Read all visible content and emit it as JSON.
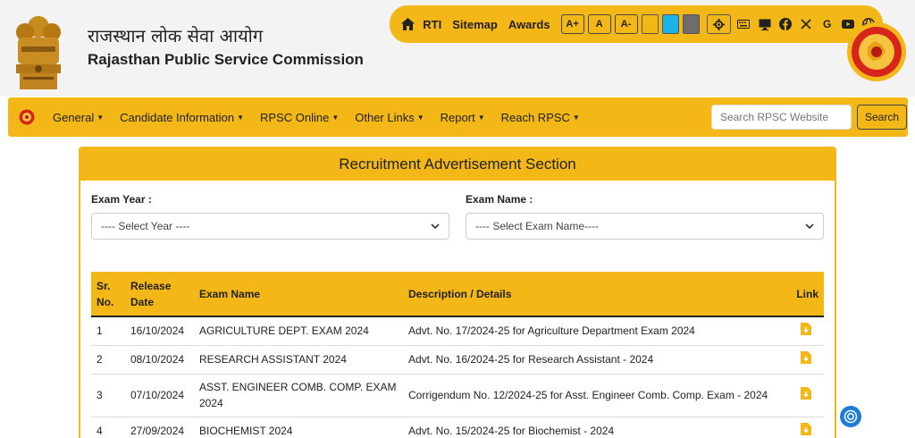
{
  "header": {
    "title_hindi": "राजस्थान लोक सेवा आयोग",
    "title_english": "Rajasthan Public Service Commission"
  },
  "toolbar": {
    "links": [
      "RTI",
      "Sitemap",
      "Awards"
    ],
    "font_buttons": [
      "A+",
      "A",
      "A-"
    ],
    "swatches": [
      "#f3b717",
      "#1ab4e8",
      "#6d6d6d"
    ],
    "icons": [
      "home-icon",
      "gear-icon",
      "keyboard-icon",
      "monitor-icon",
      "facebook-icon",
      "x-icon",
      "google-icon",
      "youtube-icon",
      "globe-icon"
    ]
  },
  "nav": {
    "items": [
      "General",
      "Candidate Information",
      "RPSC Online",
      "Other Links",
      "Report",
      "Reach RPSC"
    ],
    "search_placeholder": "Search RPSC Website",
    "search_button": "Search"
  },
  "section": {
    "title": "Recruitment Advertisement Section",
    "exam_year_label": "Exam Year :",
    "exam_year_value": "---- Select Year ----",
    "exam_name_label": "Exam Name :",
    "exam_name_value": "---- Select Exam Name----"
  },
  "table": {
    "headers": {
      "sr": "Sr.\nNo.",
      "release": "Release\nDate",
      "exam": "Exam Name",
      "desc": "Description / Details",
      "link": "Link"
    },
    "rows": [
      {
        "sr": "1",
        "date": "16/10/2024",
        "exam": "AGRICULTURE DEPT. EXAM 2024",
        "desc": "Advt. No. 17/2024-25 for Agriculture Department Exam 2024"
      },
      {
        "sr": "2",
        "date": "08/10/2024",
        "exam": "RESEARCH ASSISTANT 2024",
        "desc": "Advt. No. 16/2024-25 for Research Assistant - 2024"
      },
      {
        "sr": "3",
        "date": "07/10/2024",
        "exam": "ASST. ENGINEER COMB. COMP. EXAM 2024",
        "desc": "Corrigendum No. 12/2024-25 for Asst. Engineer Comb. Comp. Exam - 2024"
      },
      {
        "sr": "4",
        "date": "27/09/2024",
        "exam": "BIOCHEMIST 2024",
        "desc": "Advt. No. 15/2024-25 for Biochemist - 2024"
      }
    ]
  },
  "colors": {
    "accent": "#f3b717",
    "header_bg": "#f3f3f3",
    "fab": "#1e7bd6"
  }
}
